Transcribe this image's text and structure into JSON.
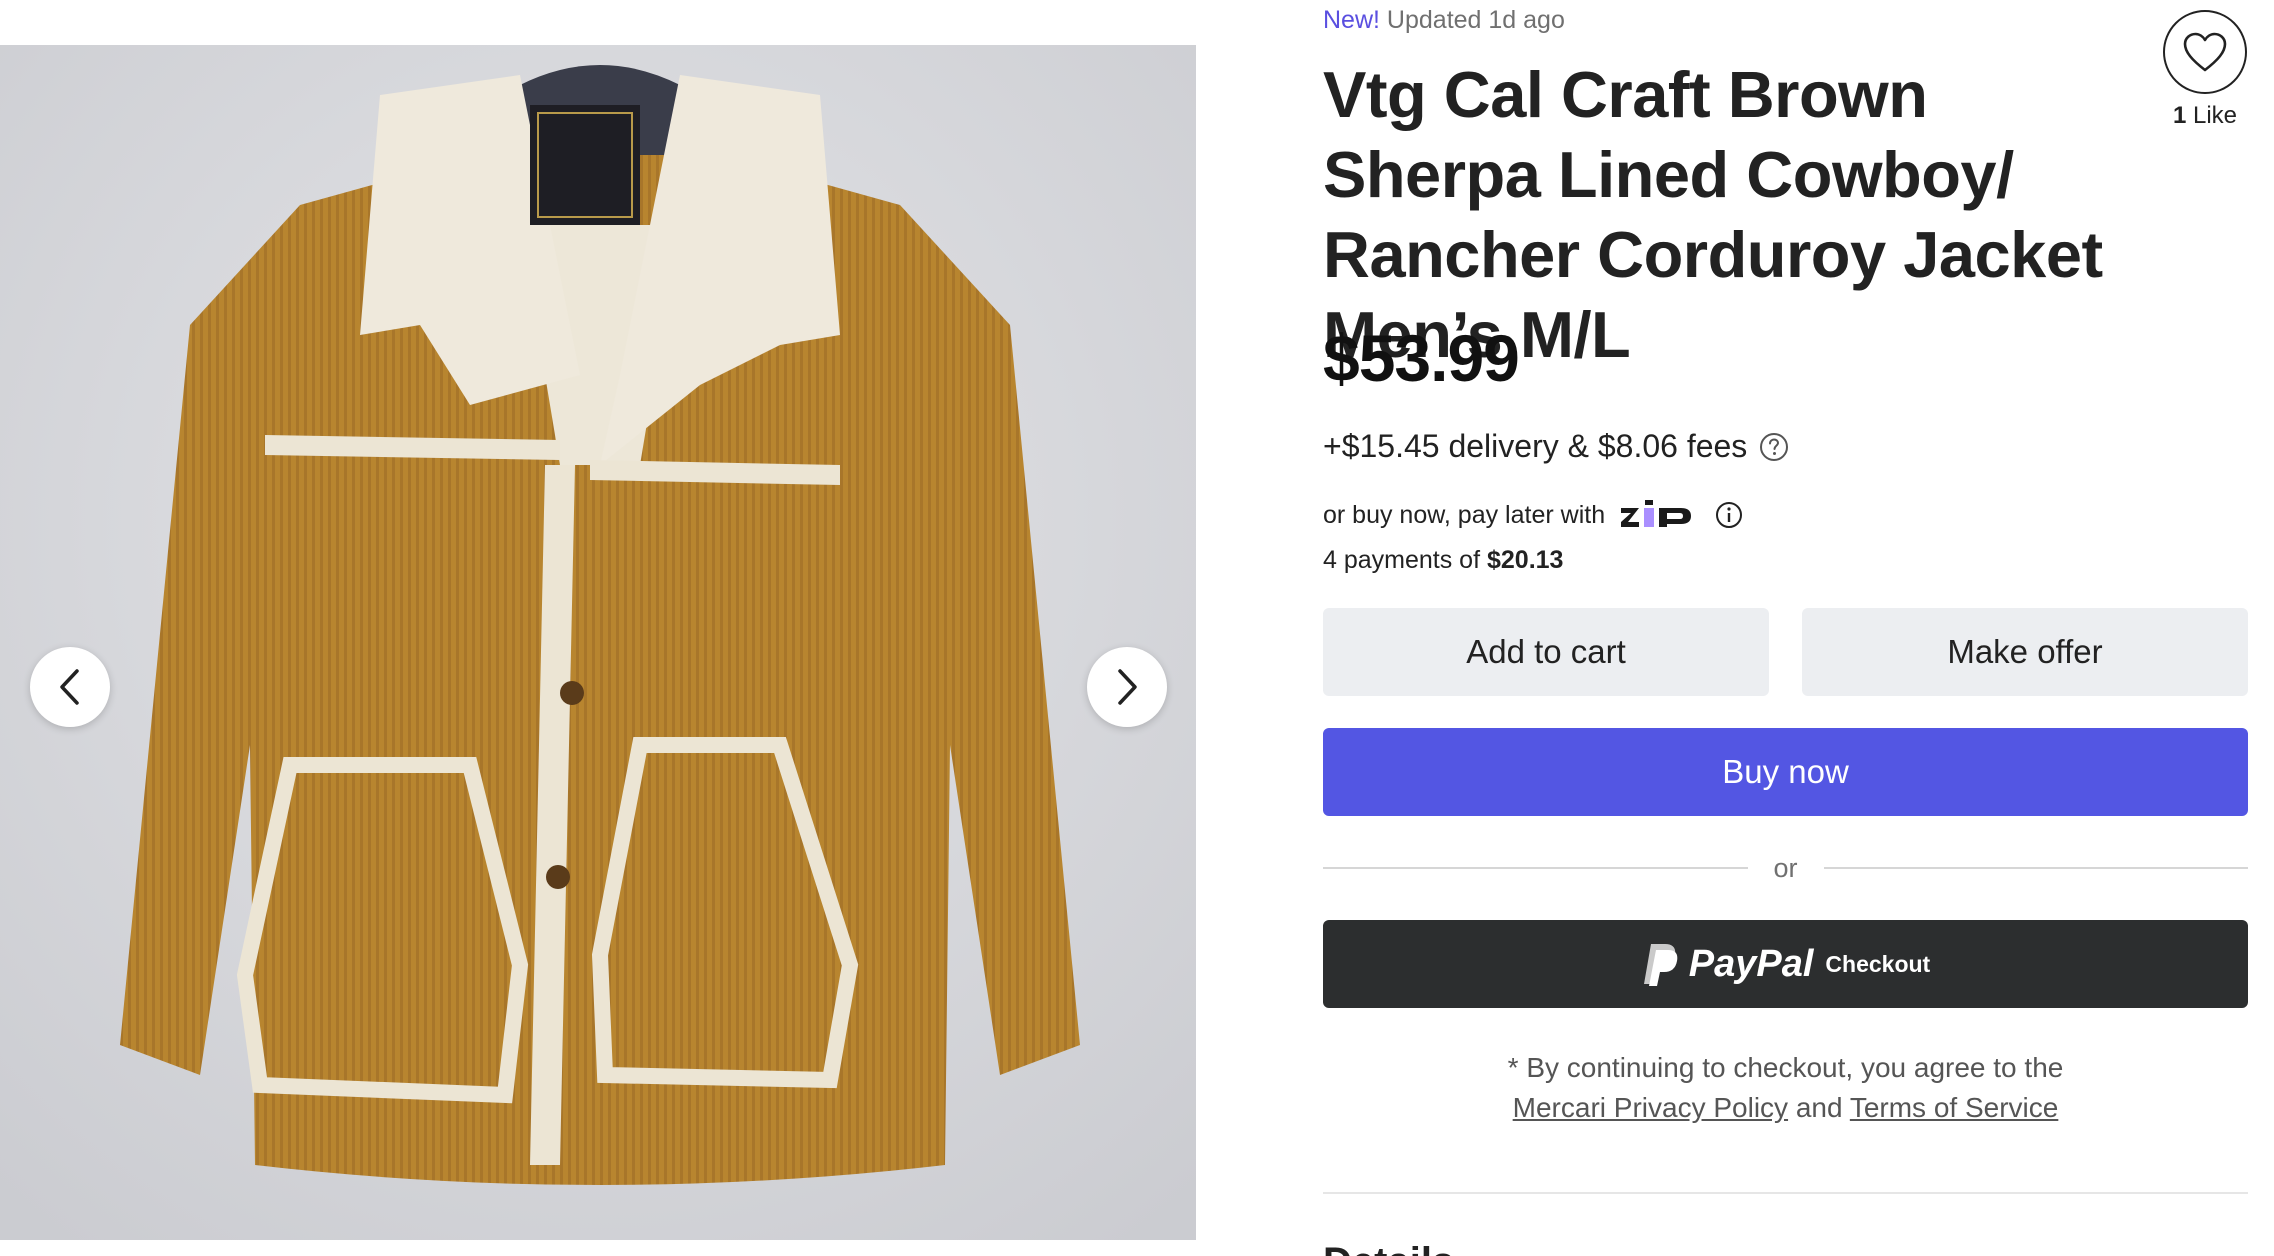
{
  "listing": {
    "new_label": "New!",
    "updated_text": "Updated 1d ago",
    "title": "Vtg Cal Craft Brown Sherpa Lined Cowboy/ Rancher Corduroy Jacket Men’s M/L",
    "price": "$53.99",
    "fees_text": "+$15.45 delivery & $8.06 fees",
    "likes": {
      "count": "1",
      "label": "Like"
    }
  },
  "gallery": {
    "image_alt": "Brown corduroy sherpa lined jacket on hanger",
    "prev_icon": "chevron-left-icon",
    "next_icon": "chevron-right-icon"
  },
  "financing": {
    "text": "or buy now, pay later with",
    "provider": "Zip",
    "installments_prefix": "4 payments of",
    "installment_amount": "$20.13"
  },
  "actions": {
    "add_to_cart": "Add to cart",
    "make_offer": "Make offer",
    "buy_now": "Buy now",
    "or": "or",
    "paypal_brand": "PayPal",
    "paypal_checkout": "Checkout"
  },
  "disclaimer": {
    "text": "* By continuing to checkout, you agree to the",
    "privacy_link": "Mercari Privacy Policy",
    "and": "and",
    "terms_link": "Terms of Service"
  },
  "next_section": {
    "heading": "Details"
  },
  "colors": {
    "accent": "#5356e3",
    "new_badge": "#5a4fe0",
    "paypal_bg": "#2c2e2f",
    "secondary_btn": "#eceef1",
    "zip_purple": "#aa8fff"
  }
}
